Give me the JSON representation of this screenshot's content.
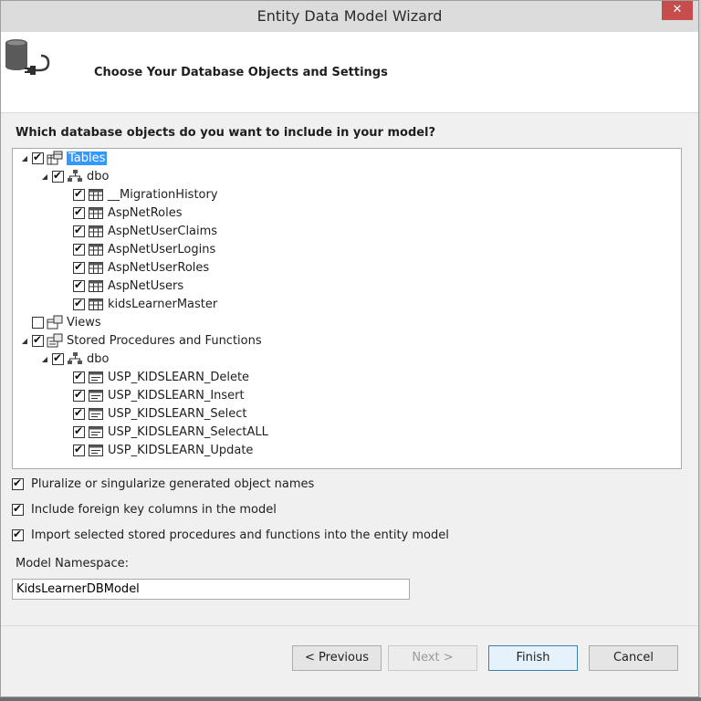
{
  "window": {
    "title": "Entity Data Model Wizard",
    "close_glyph": "✕"
  },
  "header": {
    "title": "Choose Your Database Objects and Settings"
  },
  "question": "Which database objects do you want to include in your model?",
  "tree": {
    "tables": "Tables",
    "tables_dbo": "dbo",
    "table_items": [
      "__MigrationHistory",
      "AspNetRoles",
      "AspNetUserClaims",
      "AspNetUserLogins",
      "AspNetUserRoles",
      "AspNetUsers",
      "kidsLearnerMaster"
    ],
    "views": "Views",
    "procs": "Stored Procedures and Functions",
    "procs_dbo": "dbo",
    "proc_items": [
      "USP_KIDSLEARN_Delete",
      "USP_KIDSLEARN_Insert",
      "USP_KIDSLEARN_Select",
      "USP_KIDSLEARN_SelectALL",
      "USP_KIDSLEARN_Update"
    ]
  },
  "options": {
    "pluralize": "Pluralize or singularize generated object names",
    "foreign_keys": "Include foreign key columns in the model",
    "import_procs": "Import selected stored procedures and functions into the entity model"
  },
  "namespace": {
    "label": "Model Namespace:",
    "value": "KidsLearnerDBModel"
  },
  "buttons": {
    "previous": "< Previous",
    "next": "Next >",
    "finish": "Finish",
    "cancel": "Cancel"
  },
  "colors": {
    "selection": "#3399ff",
    "close_button": "#c74c4c"
  }
}
